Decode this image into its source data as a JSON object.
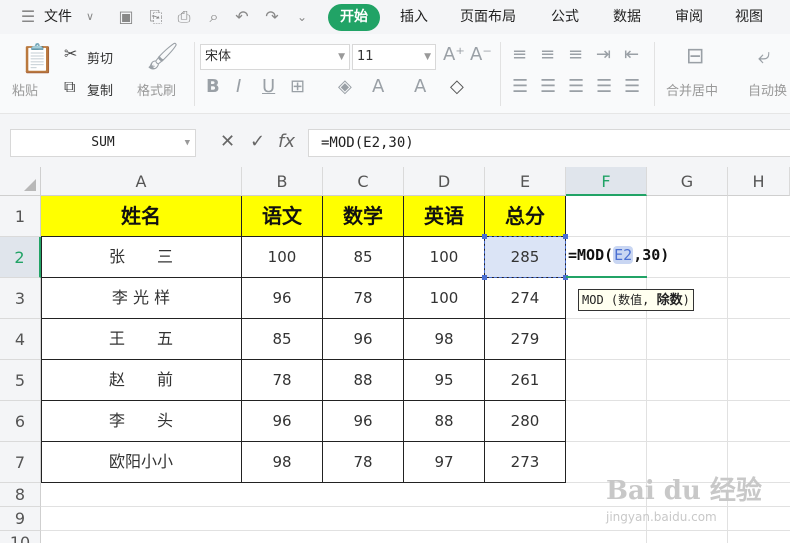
{
  "menu": {
    "file": "文件",
    "tabs": [
      "开始",
      "插入",
      "页面布局",
      "公式",
      "数据",
      "审阅",
      "视图"
    ]
  },
  "ribbon": {
    "paste": "粘贴",
    "cut": "剪切",
    "copy": "复制",
    "format_painter": "格式刷",
    "font_name": "宋体",
    "font_size": "11",
    "merge_center": "合并居中",
    "auto_wrap": "自动换"
  },
  "formula_bar": {
    "name_box": "SUM",
    "formula": "=MOD(E2,30)"
  },
  "columns": [
    "A",
    "B",
    "C",
    "D",
    "E",
    "F",
    "G",
    "H"
  ],
  "rows": [
    "1",
    "2",
    "3",
    "4",
    "5",
    "6",
    "7",
    "8",
    "9",
    "10"
  ],
  "table": {
    "headers": [
      "姓名",
      "语文",
      "数学",
      "英语",
      "总分"
    ],
    "data": [
      [
        "张　　三",
        "100",
        "85",
        "100",
        "285"
      ],
      [
        "李 光 样",
        "96",
        "78",
        "100",
        "274"
      ],
      [
        "王　　五",
        "85",
        "96",
        "98",
        "279"
      ],
      [
        "赵　　前",
        "78",
        "88",
        "95",
        "261"
      ],
      [
        "李　　头",
        "96",
        "96",
        "88",
        "280"
      ],
      [
        "欧阳小小",
        "98",
        "78",
        "97",
        "273"
      ]
    ]
  },
  "edit": {
    "prefix": "=MOD(",
    "ref": "E2",
    "suffix": ",30)"
  },
  "tooltip": {
    "func": "MOD",
    "arg1": "数值,",
    "arg2": "除数"
  },
  "watermark": {
    "brand": "Bai du 经验",
    "url": "jingyan.baidu.com"
  },
  "colors": {
    "accent": "#21a366",
    "header_fill": "#ffff00",
    "selection": "#dbe4f6"
  }
}
